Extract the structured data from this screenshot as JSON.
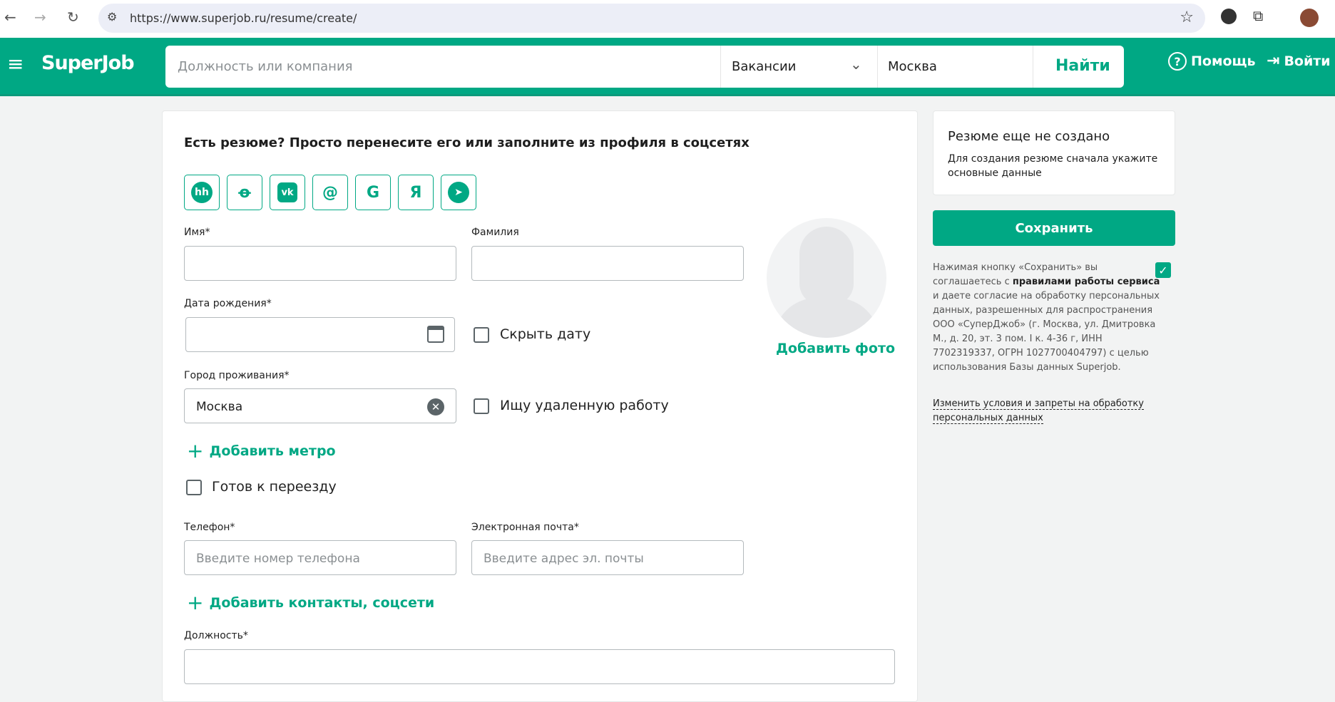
{
  "browser": {
    "url": "https://www.superjob.ru/resume/create/"
  },
  "header": {
    "logo": "SuperJob",
    "search_placeholder": "Должность или компания",
    "type_select": "Вакансии",
    "city": "Москва",
    "find_label": "Найти",
    "help_label": "Помощь",
    "login_label": "Войти"
  },
  "form": {
    "import_title": "Есть резюме? Просто перенесите его или заполните из профиля в соцсетях",
    "socials": [
      "hh",
      "ok",
      "vk",
      "@",
      "G",
      "Я",
      "telegram"
    ],
    "first_name_label": "Имя*",
    "last_name_label": "Фамилия",
    "birth_label": "Дата рождения*",
    "hide_date_label": "Скрыть дату",
    "city_label": "Город проживания*",
    "city_value": "Москва",
    "remote_label": "Ищу удаленную работу",
    "add_metro": "Добавить метро",
    "relocate_label": "Готов к переезду",
    "phone_label": "Телефон*",
    "phone_placeholder": "Введите номер телефона",
    "email_label": "Электронная почта*",
    "email_placeholder": "Введите адрес эл. почты",
    "add_contacts": "Добавить контакты, соцсети",
    "position_label": "Должность*",
    "add_photo": "Добавить фото"
  },
  "sidebar": {
    "status_title": "Резюме еще не создано",
    "status_text": "Для создания резюме сначала укажите основные данные",
    "save_label": "Сохранить",
    "legal_1": "Нажимая кнопку «Сохранить» вы соглашаетесь с ",
    "legal_rules": "правилами работы сервиса",
    "legal_2": " и даете  согласие на обработку персональных данных, разрешенных для распространения ООО «СуперДжоб» (г. Москва, ул. Дмитровка М., д. 20, эт. 3 пом. I к. 4-36 г, ИНН 7702319337, ОГРН 1027700404797) с целью использования Базы данных Superjob.",
    "change_link": "Изменить условия и запреты на обработку персональных данных"
  }
}
